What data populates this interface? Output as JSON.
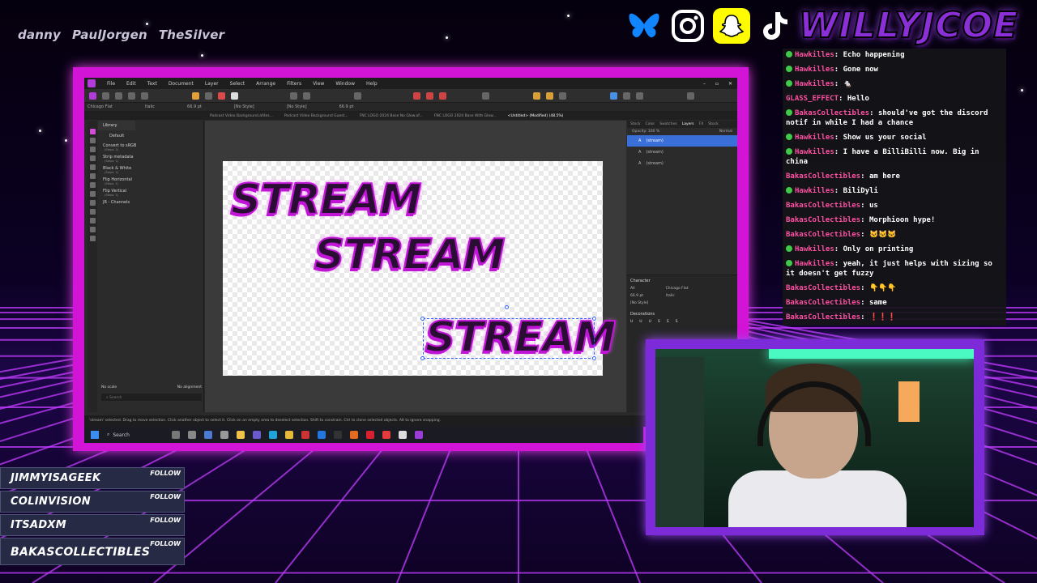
{
  "ticker": {
    "names": [
      "danny",
      "PaulJorgen",
      "TheSilver"
    ]
  },
  "brand": {
    "name": "WILLYJCOE"
  },
  "socials": [
    {
      "icon": "bluesky-icon",
      "color": "#1185fe"
    },
    {
      "icon": "instagram-icon",
      "color": "#ffffff"
    },
    {
      "icon": "snapchat-icon",
      "color": "#fffc00"
    },
    {
      "icon": "tiktok-icon",
      "color": "#ffffff"
    }
  ],
  "app": {
    "menu": [
      "File",
      "Edit",
      "Text",
      "Document",
      "Layer",
      "Select",
      "Arrange",
      "Filters",
      "View",
      "Window",
      "Help"
    ],
    "context": {
      "font": "Chicago Flat",
      "style": "Italic",
      "size": "66.9 pt",
      "para_style": "[No Style]",
      "char_style": "[No Style]",
      "size2": "66.9 pt"
    },
    "doc_tabs": [
      "Podcast Video Background.afdes...",
      "Podcast Video Background Guest...",
      "FNC LOGO 2024 Base No Glow.af...",
      "FNC LOGO 2024 Base With Glow...",
      "<Untitled> (Modified) (48.5%)"
    ],
    "library": {
      "tab": "Library",
      "group": "Default",
      "items": [
        {
          "label": "Convert to sRGB",
          "steps": "(Steps: 2)"
        },
        {
          "label": "Strip metadata",
          "steps": "(Steps: 1)"
        },
        {
          "label": "Black & White",
          "steps": "(Steps: 2)"
        },
        {
          "label": "Flip Horizontal",
          "steps": "(Steps: 1)"
        },
        {
          "label": "Flip Vertical",
          "steps": "(Steps: 1)"
        },
        {
          "label": "JR - Channels",
          "steps": ""
        }
      ],
      "scale": "No scale",
      "align": "No alignment",
      "search": "Search"
    },
    "canvas": {
      "texts": [
        "STREAM",
        "STREAM",
        "STREAM"
      ]
    },
    "right_panel": {
      "tabs": [
        "Stock",
        "Color",
        "Swatches",
        "Layers",
        "FX",
        "Stock"
      ],
      "opacity": "Opacity: 100 %",
      "blend": "Normal",
      "layers": [
        "(stream)",
        "(stream)",
        "(stream)"
      ],
      "character": {
        "title": "Character",
        "scope": "All",
        "font": "Chicago Flat",
        "size": "66.9 pt",
        "style": "Italic",
        "para_style": "[No Style]",
        "decorations": "Decorations"
      }
    },
    "status": "'stream' selected. Drag to move selection. Click another object to select it. Click on an empty area to deselect selection. Shift to constrain. Ctrl to clone selected objects. Alt to ignore snapping.",
    "taskbar": {
      "search": "Search"
    }
  },
  "chat": [
    {
      "user": "Hawkilles",
      "text": "Echo happening"
    },
    {
      "user": "Hawkilles",
      "text": "Gone now"
    },
    {
      "user": "Hawkilles",
      "text": "🐁"
    },
    {
      "user": "GLASS_EFFECT",
      "text": "Hello"
    },
    {
      "user": "BakasCollectibles",
      "text": "should've got the discord notif in while I had a chance"
    },
    {
      "user": "Hawkilles",
      "text": "Show us your social"
    },
    {
      "user": "Hawkilles",
      "text": "I have a BilliBilli now. Big in china"
    },
    {
      "user": "BakasCollectibles",
      "text": "am here"
    },
    {
      "user": "Hawkilles",
      "text": "BiliDyli"
    },
    {
      "user": "BakasCollectibles",
      "text": "us"
    },
    {
      "user": "BakasCollectibles",
      "text": "Morphioon hype!"
    },
    {
      "user": "BakasCollectibles",
      "text": "🐱🐱🐱"
    },
    {
      "user": "Hawkilles",
      "text": "Only on printing"
    },
    {
      "user": "Hawkilles",
      "text": "yeah, it just helps with sizing so it doesn't get fuzzy"
    },
    {
      "user": "BakasCollectibles",
      "text": "👇👇👇"
    },
    {
      "user": "BakasCollectibles",
      "text": "same"
    },
    {
      "user": "BakasCollectibles",
      "text": "❗❗❗"
    }
  ],
  "follows": [
    {
      "name": "JIMMYISAGEEK",
      "tag": "FOLLOW"
    },
    {
      "name": "COLINVISION",
      "tag": "FOLLOW"
    },
    {
      "name": "ITSADXM",
      "tag": "FOLLOW"
    },
    {
      "name": "BAKASCOLLECTIBLES",
      "tag": "FOLLOW"
    }
  ]
}
